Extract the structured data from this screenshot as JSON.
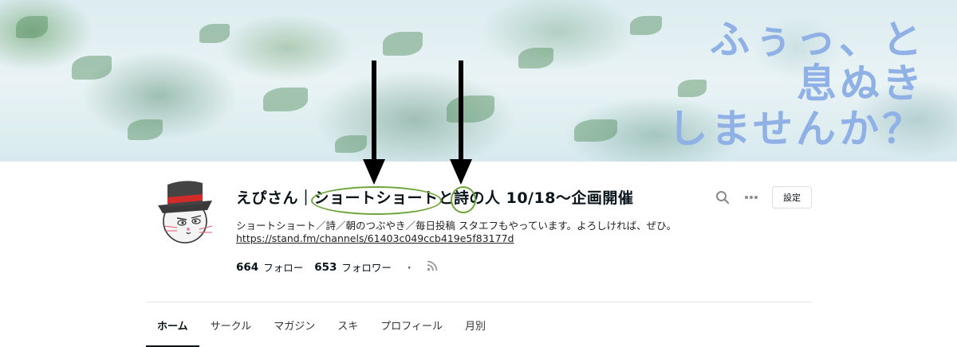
{
  "banner": {
    "line1": "ふぅっ、と",
    "line2": "息ぬき",
    "line3": "しませんか？"
  },
  "profile": {
    "name": "えぴさん｜ショートショートと詩の人 10/18〜企画開催",
    "description": "ショートショート／詩／朝のつぶやき／毎日投稿 スタエフもやっています。よろしければ、ぜひ。",
    "link": "https://stand.fm/channels/61403c049ccb419e5f83177d"
  },
  "stats": {
    "follow_count": "664",
    "follow_label": "フォロー",
    "follower_count": "653",
    "follower_label": "フォロワー",
    "separator": "・"
  },
  "actions": {
    "settings_label": "設定"
  },
  "icons": {
    "search": "search-icon",
    "more": "more-icon",
    "rss": "rss-icon"
  },
  "tabs": [
    {
      "label": "ホーム",
      "active": true
    },
    {
      "label": "サークル"
    },
    {
      "label": "マガジン"
    },
    {
      "label": "スキ"
    },
    {
      "label": "プロフィール"
    },
    {
      "label": "月別"
    }
  ],
  "colors": {
    "banner_text": "#8fb1e6",
    "annotation_ellipse": "#6ca33a",
    "annotation_arrow": "#000000"
  }
}
